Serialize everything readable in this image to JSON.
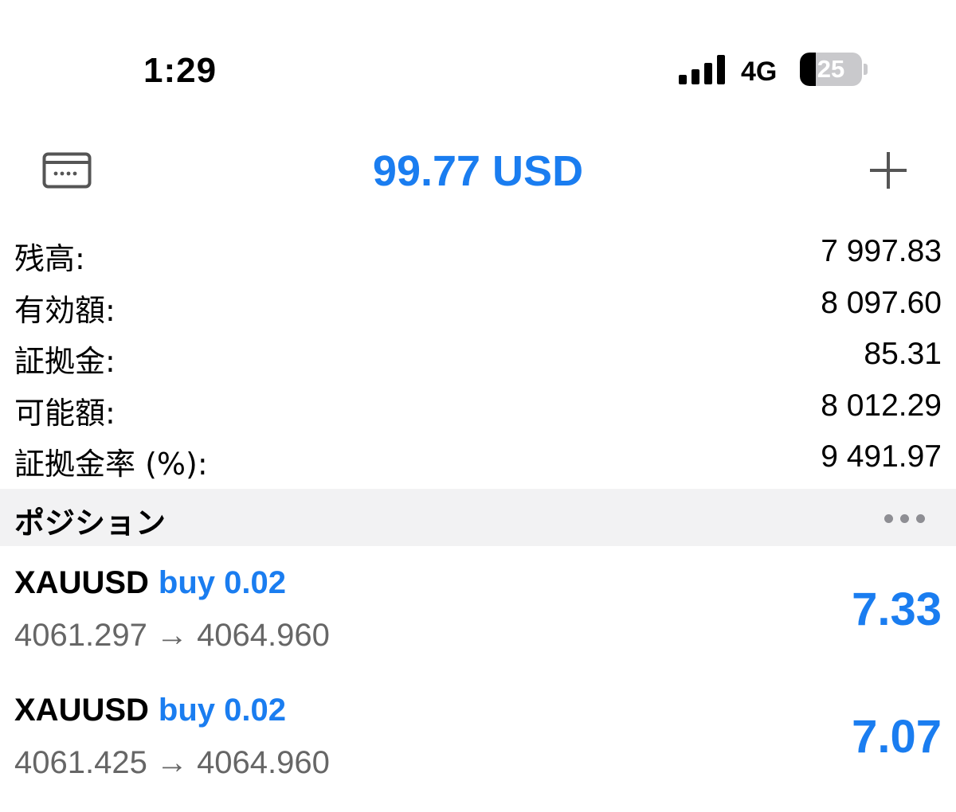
{
  "status_bar": {
    "time": "1:29",
    "network": "4G",
    "battery_percent": 25,
    "battery_label": "25"
  },
  "header": {
    "title": "99.77 USD",
    "left_icon": "card-icon",
    "right_icon": "plus-icon"
  },
  "summary": [
    {
      "label": "残高:",
      "value": "7 997.83"
    },
    {
      "label": "有効額:",
      "value": "8 097.60"
    },
    {
      "label": "証拠金:",
      "value": "85.31"
    },
    {
      "label": "可能額:",
      "value": "8 012.29"
    },
    {
      "label": "証拠金率 (%):",
      "value": "9 491.97"
    }
  ],
  "positions_section": {
    "title": "ポジション",
    "more_icon": "more-icon"
  },
  "positions": [
    {
      "symbol": "XAUUSD",
      "side": "buy 0.02",
      "prices": "4061.297 → 4064.960",
      "profit": "7.33"
    },
    {
      "symbol": "XAUUSD",
      "side": "buy 0.02",
      "prices": "4061.425 → 4064.960",
      "profit": "7.07"
    }
  ],
  "colors": {
    "accent": "#1a7df0",
    "section_bg": "#f2f2f3",
    "secondary_text": "#666666"
  }
}
